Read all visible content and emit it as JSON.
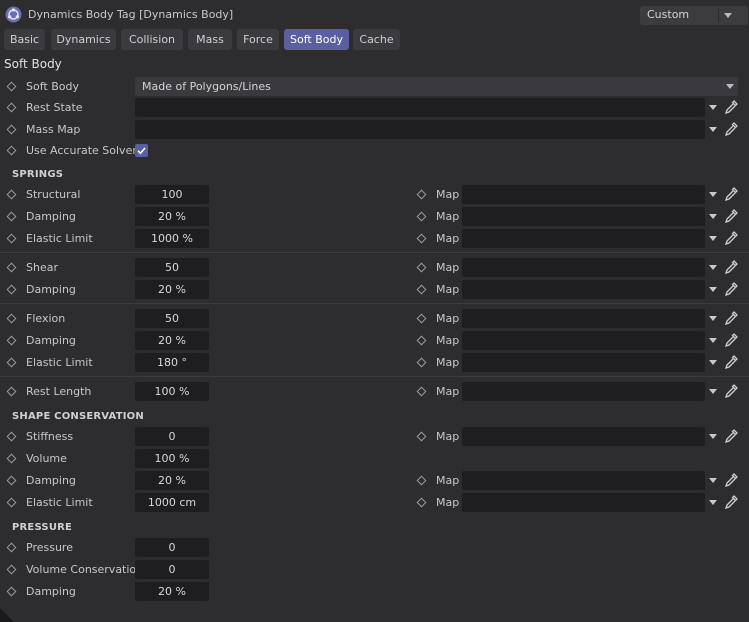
{
  "window": {
    "title": "Dynamics Body Tag [Dynamics Body]",
    "preset": "Custom"
  },
  "tabs": [
    "Basic",
    "Dynamics",
    "Collision",
    "Mass",
    "Force",
    "Soft Body",
    "Cache"
  ],
  "active_tab": "Soft Body",
  "section_title": "Soft Body",
  "soft_body": {
    "mode_label": "Soft Body",
    "mode_value": "Made of Polygons/Lines",
    "rest_state_label": "Rest State",
    "mass_map_label": "Mass Map",
    "accurate_solver_label": "Use Accurate Solver",
    "accurate_solver_checked": true
  },
  "map_label": "Map",
  "springs": {
    "heading": "SPRINGS",
    "rows": [
      {
        "label": "Structural",
        "value": "100"
      },
      {
        "label": "Damping",
        "value": "20 %"
      },
      {
        "label": "Elastic Limit",
        "value": "1000 %"
      },
      {
        "label": "Shear",
        "value": "50"
      },
      {
        "label": "Damping",
        "value": "20 %"
      },
      {
        "label": "Flexion",
        "value": "50"
      },
      {
        "label": "Damping",
        "value": "20 %"
      },
      {
        "label": "Elastic Limit",
        "value": "180 °"
      },
      {
        "label": "Rest Length",
        "value": "100 %"
      }
    ]
  },
  "shape_conservation": {
    "heading": "SHAPE CONSERVATION",
    "rows": [
      {
        "label": "Stiffness",
        "value": "0"
      },
      {
        "label": "Volume",
        "value": "100 %"
      },
      {
        "label": "Damping",
        "value": "20 %"
      },
      {
        "label": "Elastic Limit",
        "value": "1000 cm"
      }
    ]
  },
  "pressure": {
    "heading": "PRESSURE",
    "rows": [
      {
        "label": "Pressure",
        "value": "0"
      },
      {
        "label": "Volume Conservation",
        "value": "0"
      },
      {
        "label": "Damping",
        "value": "20 %"
      }
    ]
  },
  "colors": {
    "background": "#2d2c2f",
    "field": "#1e1e21",
    "accent": "#5a5f9f"
  },
  "icons": [
    "dynamics-tag-icon",
    "keyframe-diamond-icon",
    "chevron-down-icon",
    "eyedropper-icon",
    "checkmark-icon"
  ]
}
